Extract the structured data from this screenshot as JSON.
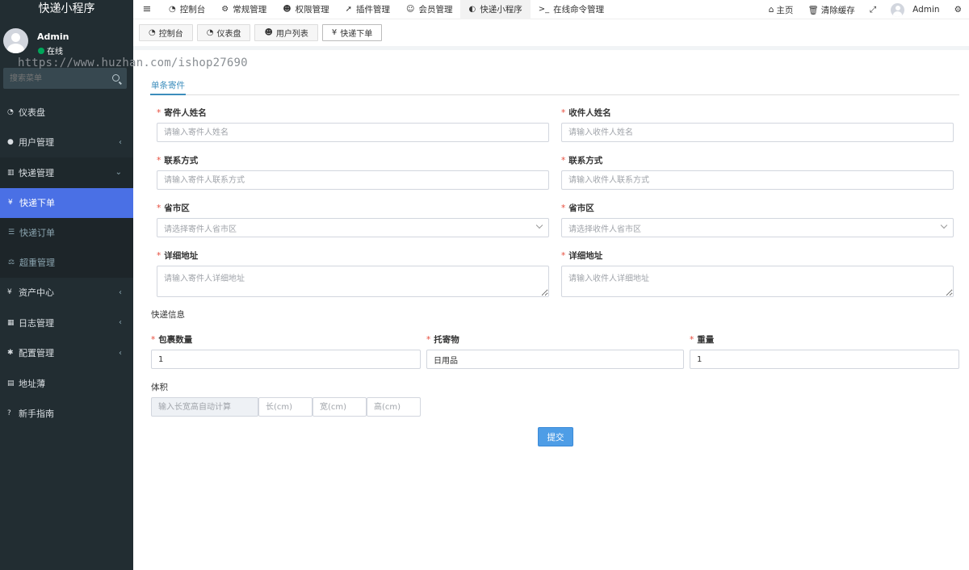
{
  "sidebar": {
    "brand": "快递小程序",
    "user_name": "Admin",
    "user_status": "在线",
    "search_placeholder": "搜索菜单",
    "watermark": "https://www.huzhan.com/ishop27690",
    "menu": [
      {
        "label": "仪表盘",
        "icon": "dashboard-icon"
      },
      {
        "label": "用户管理",
        "icon": "user-icon"
      },
      {
        "label": "快递管理",
        "icon": "list-icon"
      },
      {
        "label": "快递下单",
        "icon": "yen-icon"
      },
      {
        "label": "快递订单",
        "icon": "list-icon"
      },
      {
        "label": "超重管理",
        "icon": "weight-icon"
      },
      {
        "label": "资产中心",
        "icon": "yen-icon"
      },
      {
        "label": "日志管理",
        "icon": "calendar-icon"
      },
      {
        "label": "配置管理",
        "icon": "gear-icon"
      },
      {
        "label": "地址薄",
        "icon": "book-icon"
      },
      {
        "label": "新手指南",
        "icon": "question-icon"
      }
    ]
  },
  "topnav": {
    "items": [
      {
        "label": "控制台",
        "icon": "dashboard-icon"
      },
      {
        "label": "常规管理",
        "icon": "cogs-icon"
      },
      {
        "label": "权限管理",
        "icon": "group-icon"
      },
      {
        "label": "插件管理",
        "icon": "rocket-icon"
      },
      {
        "label": "会员管理",
        "icon": "user-circle-icon"
      },
      {
        "label": "快递小程序",
        "icon": "circle-half-icon"
      },
      {
        "label": "在线命令管理",
        "icon": "terminal-icon"
      }
    ],
    "home": "主页",
    "clear_cache": "清除缓存",
    "admin": "Admin"
  },
  "tabs": [
    {
      "label": "控制台"
    },
    {
      "label": "仪表盘"
    },
    {
      "label": "用户列表"
    },
    {
      "label": "快递下单"
    }
  ],
  "form": {
    "tab_label": "单条寄件",
    "sender_name_label": "寄件人姓名",
    "sender_name_placeholder": "请输入寄件人姓名",
    "receiver_name_label": "收件人姓名",
    "receiver_name_placeholder": "请输入收件人姓名",
    "sender_phone_label": "联系方式",
    "sender_phone_placeholder": "请输入寄件人联系方式",
    "receiver_phone_label": "联系方式",
    "receiver_phone_placeholder": "请输入收件人联系方式",
    "sender_region_label": "省市区",
    "sender_region_placeholder": "请选择寄件人省市区",
    "receiver_region_label": "省市区",
    "receiver_region_placeholder": "请选择收件人省市区",
    "sender_address_label": "详细地址",
    "sender_address_placeholder": "请输入寄件人详细地址",
    "receiver_address_label": "详细地址",
    "receiver_address_placeholder": "请输入收件人详细地址",
    "express_info_title": "快递信息",
    "package_count_label": "包裹数量",
    "package_count_value": "1",
    "goods_label": "托寄物",
    "goods_value": "日用品",
    "weight_label": "重量",
    "weight_value": "1",
    "volume_label": "体积",
    "volume_auto_placeholder": "输入长宽高自动计算",
    "length_placeholder": "长(cm)",
    "width_placeholder": "宽(cm)",
    "height_placeholder": "高(cm)",
    "submit_label": "提交"
  }
}
